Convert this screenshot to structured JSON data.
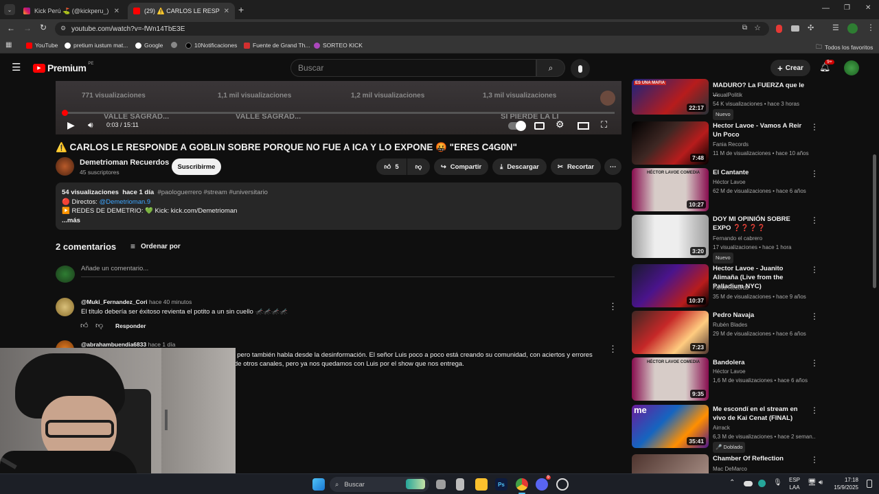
{
  "browser": {
    "tabs": [
      {
        "title": "Kick Perú ⛳ (@kickperu_) • Fot",
        "active": false
      },
      {
        "title": "(29) ⚠️ CARLOS LE RESPO",
        "active": true
      }
    ],
    "new_tab": "+",
    "url": "youtube.com/watch?v=-fWn14TbE3E",
    "bookmarks": [
      "YouTube",
      "pretium iustum mat...",
      "Google",
      "",
      "10Notificaciones",
      "Fuente de Grand Th...",
      "SORTEO KICK"
    ],
    "all_favorites": "Todos los favoritos"
  },
  "header": {
    "logo": "Premium",
    "region": "PE",
    "search_placeholder": "Buscar",
    "create_label": "Crear",
    "notif_count": "9+"
  },
  "player": {
    "time": "0:03 / 15:11",
    "progress_fraction": 0.0033,
    "thumb_texts": [
      "771 visualizaciones",
      "1,1 mil visualizaciones",
      "1,2 mil visualizaciones",
      "1,3 mil visualizaciones",
      "VALLE SAGRAD...",
      "VALLE SAGRAD...",
      "SI PIERDE LA LI"
    ]
  },
  "video": {
    "title": "⚠️ CARLOS LE RESPONDE A GOBLIN SOBRE PORQUE NO FUE A ICA Y LO EXPONE 🤬 \"ERES C4G0N\"",
    "channel": "Demetrioman Recuerdos",
    "subscribers": "45 suscriptores",
    "subscribe_label": "Suscribirme",
    "likes": "5",
    "share_label": "Compartir",
    "download_label": "Descargar",
    "clip_label": "Recortar",
    "more": "⋯"
  },
  "description": {
    "views": "54 visualizaciones",
    "date": "hace 1 día",
    "tags": "#paologuerrero #stream #universitario",
    "line1_prefix": "🔴 Directos: ",
    "line1_link": "@Demetrioman.9",
    "line2": "▶️ REDES DE DEMETRIO: 💚 Kick: kick.com/Demetrioman",
    "more": "...más"
  },
  "comments": {
    "count_label": "2 comentarios",
    "sort_label": "Ordenar por",
    "add_placeholder": "Añade un comentario...",
    "items": [
      {
        "author": "@Muki_Fernandez_Cori",
        "time": "hace 40 minutos",
        "text": "El título debería ser éxitoso revienta el potito a un sin cuello 🦟🦟🦟🦟",
        "reply_label": "Responder"
      },
      {
        "author": "@abrahambuendia6833",
        "time": "hace 1 día",
        "text_line1": ", pero también habla desde la desinformación. El señor Luis poco a poco está creando su comunidad, con aciertos y errores",
        "text_line2": "de otros canales, pero ya nos quedamos con Luis por el show que nos entrega."
      }
    ]
  },
  "sidebar": [
    {
      "title": "MADURO? La FUERZA que le ...",
      "channel": "VisualPolitik",
      "meta": "54 K visualizaciones • hace 3 horas",
      "badge": "Nuevo",
      "duration": "22:17",
      "thumb_label": "ES UNA MAFIA"
    },
    {
      "title": "Hector Lavoe - Vamos A Reir Un Poco",
      "channel": "Fania Records",
      "meta": "11 M de visualizaciones • hace 10 años",
      "badge": "",
      "duration": "7:48",
      "thumb_label": ""
    },
    {
      "title": "El Cantante",
      "channel": "Héctor Lavoe",
      "meta": "62 M de visualizaciones • hace 6 años",
      "badge": "",
      "duration": "10:27",
      "thumb_label": "HÉCTOR LAVOE COMEDIA"
    },
    {
      "title": "DOY MI OPINIÓN SOBRE EXPO ❓❓❓❓",
      "channel": "Fernando el cabrero",
      "meta": "17 visualizaciones • hace 1 hora",
      "badge": "Nuevo",
      "duration": "3:20",
      "thumb_label": ""
    },
    {
      "title": "Hector Lavoe - Juanito Alimaña (Live from the Palladium NYC)",
      "channel": "Fania Records",
      "meta": "35 M de visualizaciones • hace 9 años",
      "badge": "",
      "duration": "10:37",
      "thumb_label": ""
    },
    {
      "title": "Pedro Navaja",
      "channel": "Rubén Blades",
      "meta": "29 M de visualizaciones • hace 6 años",
      "badge": "",
      "duration": "7:23",
      "thumb_label": ""
    },
    {
      "title": "Bandolera",
      "channel": "Héctor Lavoe",
      "meta": "1,6 M de visualizaciones • hace 6 años",
      "badge": "",
      "duration": "9:35",
      "thumb_label": "HÉCTOR LAVOE COMEDIA"
    },
    {
      "title": "Me escondí en el stream en vivo de Kai Cenat (FINAL)",
      "channel": "Airrack",
      "meta": "6,3 M de visualizaciones • hace 2 seman...",
      "badge": "🎤 Doblado",
      "duration": "35:41",
      "thumb_label": "me"
    },
    {
      "title": "Chamber Of Reflection",
      "channel": "Mac DeMarco",
      "meta": "",
      "badge": "",
      "duration": "",
      "thumb_label": ""
    }
  ],
  "taskbar": {
    "search_label": "Buscar",
    "lang_line1": "ESP",
    "lang_line2": "LAA",
    "time": "17:18",
    "date": "15/9/2025",
    "discord_badge": "9"
  },
  "colors": {
    "yt_red": "#ff0000",
    "link_blue": "#3ea6ff",
    "bg": "#0f0f0f"
  }
}
